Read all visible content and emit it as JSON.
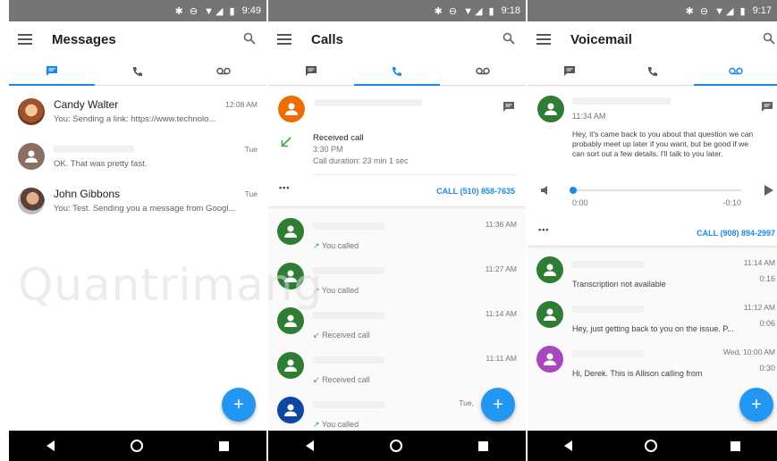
{
  "status": {
    "time1": "9:49",
    "time2": "9:18",
    "time3": "9:17"
  },
  "messages": {
    "title": "Messages",
    "items": [
      {
        "name": "Candy Walter",
        "preview": "You: Sending a link: https://www.technolo...",
        "time": "12:08 AM"
      },
      {
        "name": "",
        "preview": "OK. That was pretty fast.",
        "time": "Tue"
      },
      {
        "name": "John Gibbons",
        "preview": "You: Test. Sending you a message from Googl...",
        "time": "Tue"
      }
    ],
    "fab": "+"
  },
  "calls": {
    "title": "Calls",
    "expanded": {
      "type": "Received call",
      "time": "3:30 PM",
      "duration": "Call duration: 23 min 1 sec",
      "call_link": "CALL (510) 858-7635",
      "more": "•••"
    },
    "items": [
      {
        "type": "You called",
        "time": "11:36 AM"
      },
      {
        "type": "You called",
        "time": "11:27 AM"
      },
      {
        "type": "Received call",
        "time": "11:14 AM"
      },
      {
        "type": "Received call",
        "time": "11:11 AM"
      },
      {
        "type": "You called",
        "time": "Tue,"
      }
    ],
    "fab": "+"
  },
  "voicemail": {
    "title": "Voicemail",
    "expanded": {
      "time": "11:34 AM",
      "transcript": "Hey, it's came back to you about that question we can probably meet up later if you want, but be good if we can sort out a few details. I'll talk to you later.",
      "elapsed": "0:00",
      "remaining": "-0:10",
      "call_link": "CALL (908) 894-2997",
      "more": "•••"
    },
    "items": [
      {
        "time": "11:14 AM",
        "text": "Transcription not available",
        "duration": "0:16"
      },
      {
        "time": "11:12 AM",
        "text": "Hey, just getting back to you on the issue. P...",
        "duration": "0:06"
      },
      {
        "time": "Wed, 10:00 AM",
        "text": "Hi, Derek. This is Allison calling from",
        "duration": "0:30"
      }
    ],
    "fab": "+"
  },
  "watermark": "Quantrimang",
  "colors": {
    "accent": "#1e88e5",
    "green": "#2e7d32",
    "orange": "#ef6c00",
    "purple": "#ab47bc",
    "navy": "#0d47a1",
    "brown": "#8d6e63"
  }
}
